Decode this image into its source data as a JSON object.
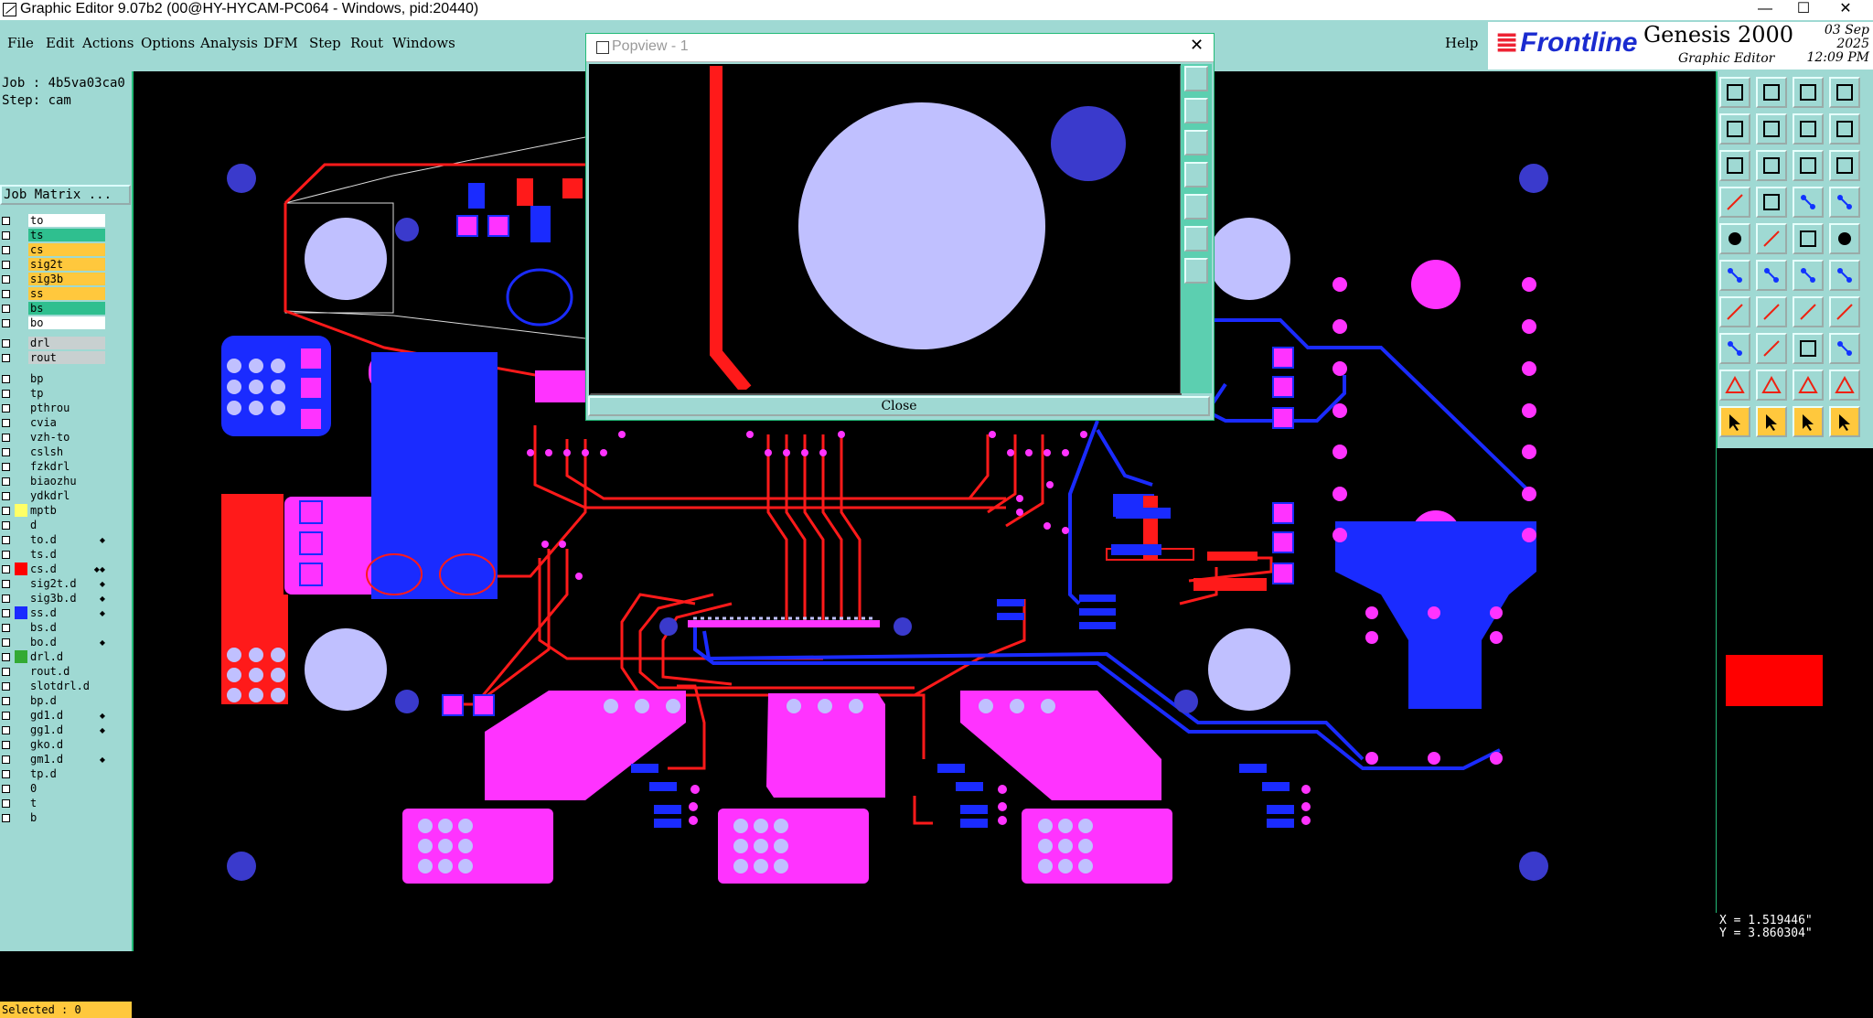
{
  "window": {
    "title": "Graphic Editor 9.07b2 (00@HY-HYCAM-PC064 - Windows, pid:20440)",
    "controls": [
      "—",
      "☐",
      "✕"
    ]
  },
  "menubar": {
    "items": [
      "File",
      "Edit",
      "Actions",
      "Options",
      "Analysis",
      "DFM",
      "Step",
      "Rout",
      "Windows"
    ],
    "help": "Help"
  },
  "branding": {
    "logo": "Frontline",
    "product": "Genesis 2000",
    "subtitle": "Graphic Editor",
    "date": "03 Sep 2025",
    "time": "12:09 PM"
  },
  "left_panel": {
    "job": "Job : 4b5va03ca0",
    "step": "Step: cam",
    "job_matrix": "Job Matrix ...",
    "layers": [
      {
        "name": "to",
        "bg": "#ffffff",
        "sw": "",
        "mark": ""
      },
      {
        "name": "ts",
        "bg": "#2fbf8f",
        "sw": "",
        "mark": ""
      },
      {
        "name": "cs",
        "bg": "#ffc83d",
        "sw": "",
        "mark": ""
      },
      {
        "name": "sig2t",
        "bg": "#ffc83d",
        "sw": "",
        "mark": ""
      },
      {
        "name": "sig3b",
        "bg": "#ffc83d",
        "sw": "",
        "mark": ""
      },
      {
        "name": "ss",
        "bg": "#ffc83d",
        "sw": "",
        "mark": ""
      },
      {
        "name": "bs",
        "bg": "#2fbf8f",
        "sw": "",
        "mark": ""
      },
      {
        "name": "bo",
        "bg": "#ffffff",
        "sw": "",
        "mark": ""
      },
      {
        "name": "drl",
        "bg": "#c8d0d0",
        "sw": "",
        "mark": ""
      },
      {
        "name": "rout",
        "bg": "#c8d0d0",
        "sw": "",
        "mark": ""
      },
      {
        "name": "bp",
        "bg": "#9fd9d3",
        "sw": "",
        "mark": ""
      },
      {
        "name": "tp",
        "bg": "#9fd9d3",
        "sw": "",
        "mark": ""
      },
      {
        "name": "pthrou",
        "bg": "#9fd9d3",
        "sw": "",
        "mark": ""
      },
      {
        "name": "cvia",
        "bg": "#9fd9d3",
        "sw": "",
        "mark": ""
      },
      {
        "name": "vzh-to",
        "bg": "#9fd9d3",
        "sw": "",
        "mark": ""
      },
      {
        "name": "cslsh",
        "bg": "#9fd9d3",
        "sw": "",
        "mark": ""
      },
      {
        "name": "fzkdrl",
        "bg": "#9fd9d3",
        "sw": "",
        "mark": ""
      },
      {
        "name": "biaozhu",
        "bg": "#9fd9d3",
        "sw": "",
        "mark": ""
      },
      {
        "name": "ydkdrl",
        "bg": "#9fd9d3",
        "sw": "",
        "mark": ""
      },
      {
        "name": "mptb",
        "bg": "#9fd9d3",
        "sw": "#ffff66",
        "mark": ""
      },
      {
        "name": "d",
        "bg": "#9fd9d3",
        "sw": "",
        "mark": ""
      },
      {
        "name": "to.d",
        "bg": "#9fd9d3",
        "sw": "",
        "mark": "◆"
      },
      {
        "name": "ts.d",
        "bg": "#9fd9d3",
        "sw": "",
        "mark": ""
      },
      {
        "name": "cs.d",
        "bg": "#9fd9d3",
        "sw": "#ff0000",
        "mark": "◆◆"
      },
      {
        "name": "sig2t.d",
        "bg": "#9fd9d3",
        "sw": "",
        "mark": "◆"
      },
      {
        "name": "sig3b.d",
        "bg": "#9fd9d3",
        "sw": "",
        "mark": "◆"
      },
      {
        "name": "ss.d",
        "bg": "#9fd9d3",
        "sw": "#1a2bff",
        "mark": "◆"
      },
      {
        "name": "bs.d",
        "bg": "#9fd9d3",
        "sw": "",
        "mark": ""
      },
      {
        "name": "bo.d",
        "bg": "#9fd9d3",
        "sw": "",
        "mark": "◆"
      },
      {
        "name": "drl.d",
        "bg": "#9fd9d3",
        "sw": "#33aa33",
        "mark": ""
      },
      {
        "name": "rout.d",
        "bg": "#9fd9d3",
        "sw": "",
        "mark": ""
      },
      {
        "name": "slotdrl.d",
        "bg": "#9fd9d3",
        "sw": "",
        "mark": ""
      },
      {
        "name": "bp.d",
        "bg": "#9fd9d3",
        "sw": "",
        "mark": ""
      },
      {
        "name": "gd1.d",
        "bg": "#9fd9d3",
        "sw": "",
        "mark": "◆"
      },
      {
        "name": "gg1.d",
        "bg": "#9fd9d3",
        "sw": "",
        "mark": "◆"
      },
      {
        "name": "gko.d",
        "bg": "#9fd9d3",
        "sw": "",
        "mark": ""
      },
      {
        "name": "gm1.d",
        "bg": "#9fd9d3",
        "sw": "",
        "mark": "◆"
      },
      {
        "name": "tp.d",
        "bg": "#9fd9d3",
        "sw": "",
        "mark": ""
      },
      {
        "name": "0",
        "bg": "#9fd9d3",
        "sw": "",
        "mark": ""
      },
      {
        "name": "t",
        "bg": "#9fd9d3",
        "sw": "",
        "mark": ""
      },
      {
        "name": "b",
        "bg": "#9fd9d3",
        "sw": "",
        "mark": ""
      }
    ],
    "selected": "Selected : 0"
  },
  "popview": {
    "title": "Popview - 1",
    "close_label": "Close",
    "close_glyph": "✕"
  },
  "status": {
    "x": "X = 1.519446\"",
    "y": "Y = 3.860304\""
  },
  "colors": {
    "top_copper": "#ff1a1a",
    "bottom_copper": "#1a2bff",
    "pads": "#ff33ff",
    "holes": "#c0c0ff",
    "panel": "#9fd9d3"
  }
}
